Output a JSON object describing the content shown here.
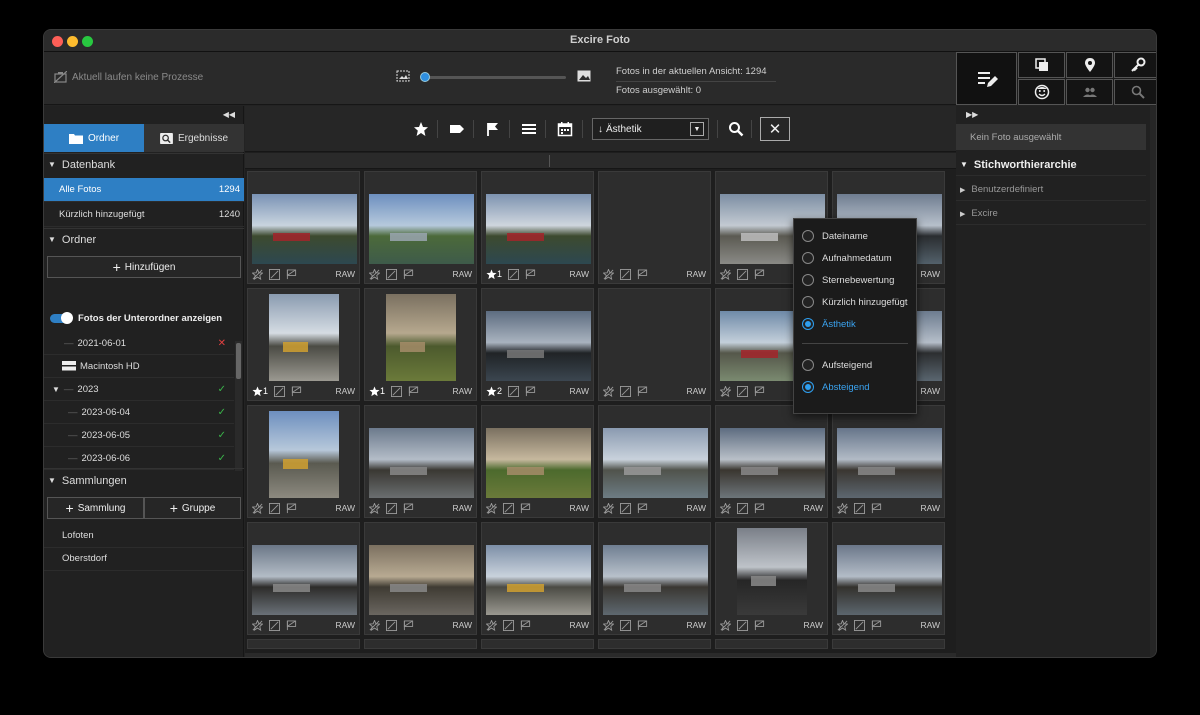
{
  "window": {
    "title": "Excire Foto"
  },
  "topbar": {
    "process_status": "Aktuell laufen keine Prozesse",
    "zoom_level": 0.02,
    "photos_in_view": "Fotos in der aktuellen Ansicht: 1294",
    "photos_selected": "Fotos ausgewählt: 0"
  },
  "left": {
    "tabs": {
      "folders": "Ordner",
      "results": "Ergebnisse"
    },
    "database_header": "Datenbank",
    "database_items": [
      {
        "label": "Alle Fotos",
        "count": "1294",
        "active": true
      },
      {
        "label": "Kürzlich hinzugefügt",
        "count": "1240",
        "active": false
      }
    ],
    "folders_header": "Ordner",
    "add_folder": "Hinzufügen",
    "show_subfolders": "Fotos der Unterordner anzeigen",
    "tree": [
      {
        "label": "2021-06-01",
        "status": "error"
      },
      {
        "label": "Macintosh HD",
        "status": ""
      },
      {
        "label": "2023",
        "status": "ok"
      },
      {
        "label": "2023-06-04",
        "status": "ok"
      },
      {
        "label": "2023-06-05",
        "status": "ok"
      },
      {
        "label": "2023-06-06",
        "status": "ok"
      }
    ],
    "collections_header": "Sammlungen",
    "add_collection": "Sammlung",
    "add_group": "Gruppe",
    "collections": [
      "Lofoten",
      "Oberstdorf"
    ]
  },
  "toolbar": {
    "sort_value": "Ästhetik"
  },
  "sort_menu": {
    "sort_by": [
      "Dateiname",
      "Aufnahmedatum",
      "Sternebewertung",
      "Kürzlich hinzugefügt",
      "Ästhetik"
    ],
    "selected_sort": "Ästhetik",
    "order": [
      "Aufsteigend",
      "Absteigend"
    ],
    "selected_order": "Absteigend"
  },
  "grid": {
    "raw_label": "RAW",
    "rating_labels": {
      "1": "1",
      "2": "2"
    }
  },
  "right": {
    "no_photo": "Kein Foto ausgewählt",
    "keyword_header": "Stichworthierarchie",
    "keyword_items": [
      "Benutzerdefiniert",
      "Excire"
    ]
  },
  "colors": {
    "accent": "#2e7fc4",
    "ok": "#3ab54a",
    "error": "#e04040"
  }
}
